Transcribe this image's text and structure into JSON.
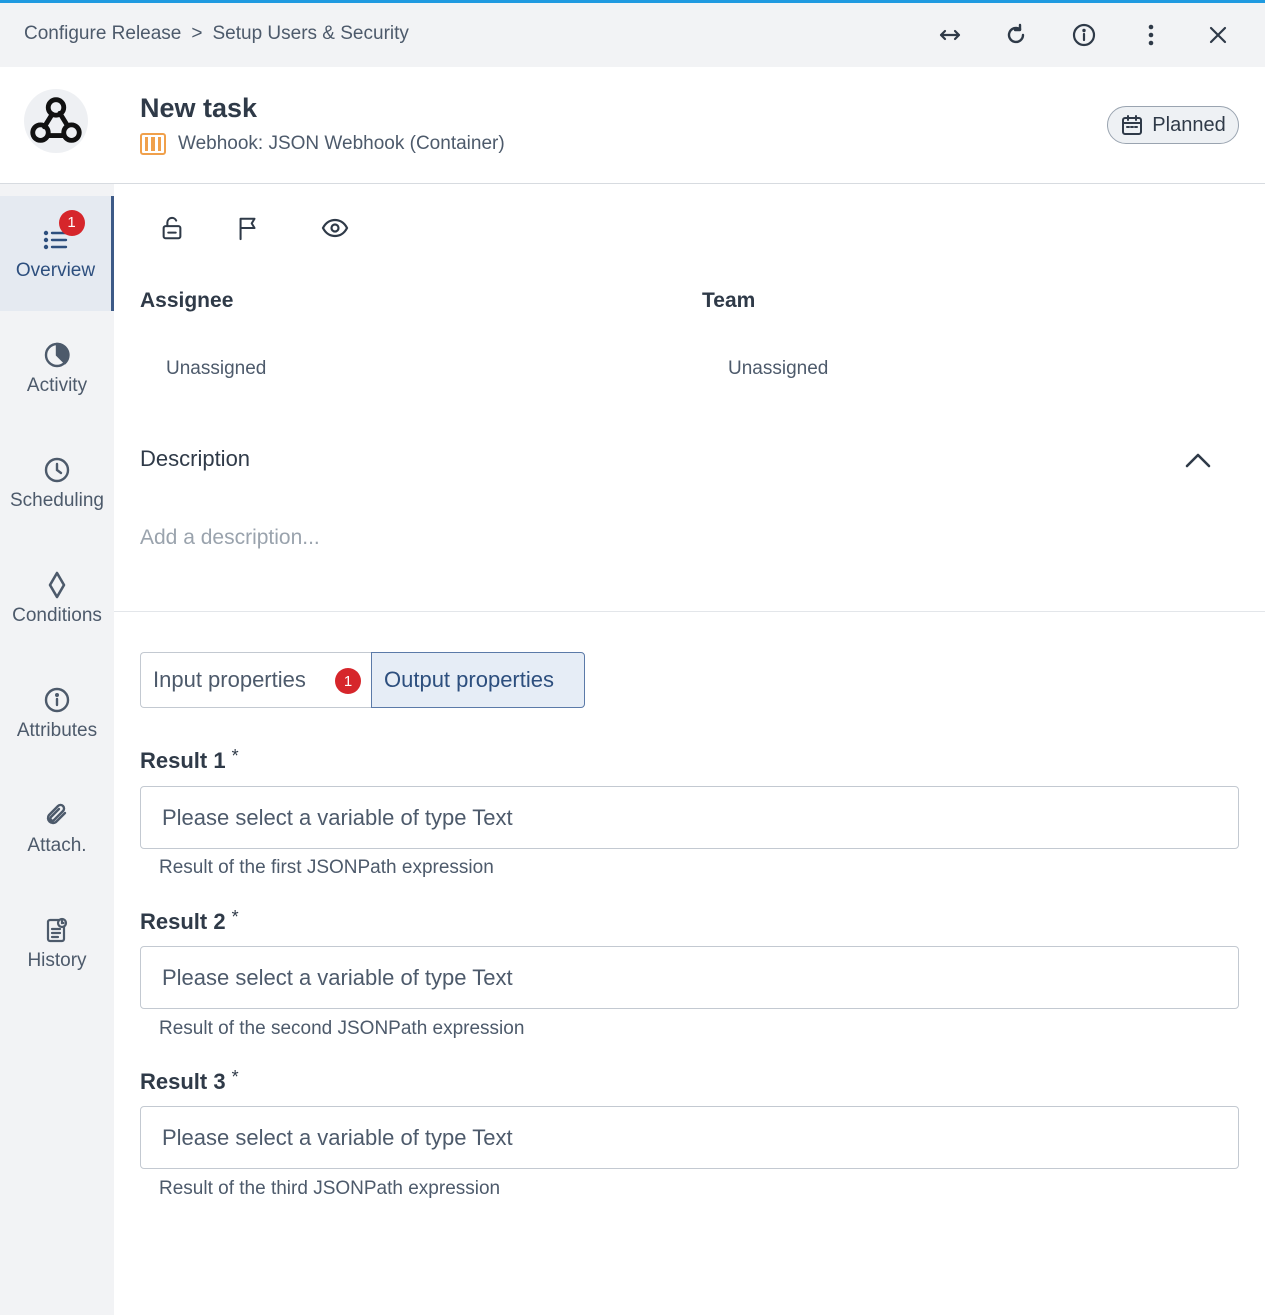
{
  "breadcrumb": [
    "Configure Release",
    "Setup Users & Security"
  ],
  "breadcrumb_separator": ">",
  "toolbar_icons": [
    "expand-horizontal-icon",
    "refresh-icon",
    "info-icon",
    "more-vertical-icon",
    "close-icon"
  ],
  "task": {
    "title": "New task",
    "type_label": "Webhook: JSON Webhook (Container)",
    "status": "Planned"
  },
  "sidebar": {
    "items": [
      {
        "label": "Overview",
        "icon": "list-icon",
        "badge": "1",
        "active": true
      },
      {
        "label": "Activity",
        "icon": "activity-icon"
      },
      {
        "label": "Scheduling",
        "icon": "clock-icon"
      },
      {
        "label": "Conditions",
        "icon": "diamond-icon"
      },
      {
        "label": "Attributes",
        "icon": "info-icon"
      },
      {
        "label": "Attach.",
        "icon": "paperclip-icon"
      },
      {
        "label": "History",
        "icon": "history-icon"
      }
    ]
  },
  "actions": [
    "unlock-icon",
    "flag-icon",
    "eye-icon"
  ],
  "assignee": {
    "label": "Assignee",
    "value": "Unassigned"
  },
  "team": {
    "label": "Team",
    "value": "Unassigned"
  },
  "description": {
    "label": "Description",
    "placeholder": "Add a description..."
  },
  "tabs": {
    "input": {
      "label": "Input properties",
      "badge": "1"
    },
    "output": {
      "label": "Output properties",
      "active": true
    }
  },
  "fields": [
    {
      "label": "Result 1",
      "required": "*",
      "placeholder": "Please select a variable of type Text",
      "help": "Result of the first JSONPath expression"
    },
    {
      "label": "Result 2",
      "required": "*",
      "placeholder": "Please select a variable of type Text",
      "help": "Result of the second JSONPath expression"
    },
    {
      "label": "Result 3",
      "required": "*",
      "placeholder": "Please select a variable of type Text",
      "help": "Result of the third JSONPath expression"
    }
  ],
  "colors": {
    "accent": "#1f9ae0",
    "active_nav": "#3d5a87",
    "badge": "#d6262b",
    "type_icon": "#f0a04b"
  }
}
